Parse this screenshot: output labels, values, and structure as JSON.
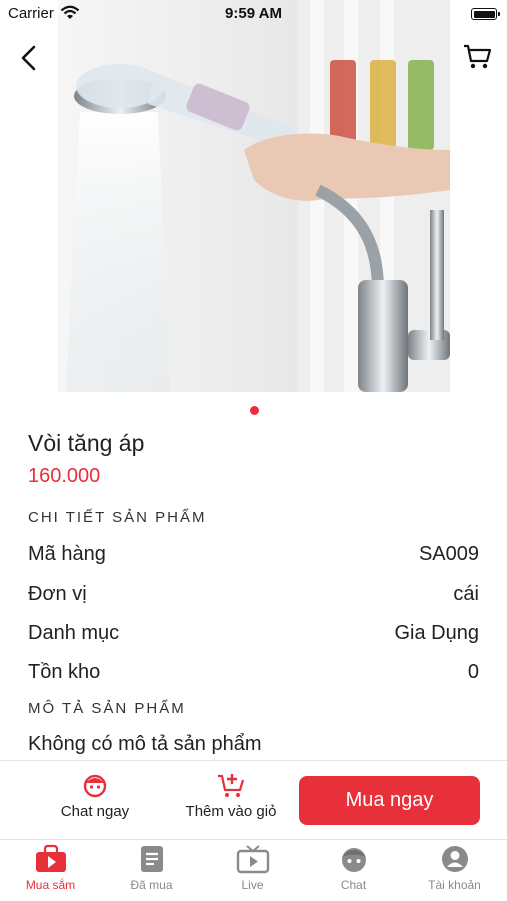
{
  "status_bar": {
    "carrier": "Carrier",
    "time": "9:59 AM"
  },
  "product": {
    "name": "Vòi tăng áp",
    "price": "160.000",
    "image_count": 1,
    "active_image_index": 0
  },
  "details": {
    "section_title": "CHI TIẾT SẢN PHẨM",
    "rows": [
      {
        "label": "Mã hàng",
        "value": "SA009"
      },
      {
        "label": "Đơn vị",
        "value": "cái"
      },
      {
        "label": "Danh mục",
        "value": "Gia Dụng"
      },
      {
        "label": "Tồn kho",
        "value": "0"
      }
    ]
  },
  "description": {
    "section_title": "MÔ TẢ SẢN PHẨM",
    "text": "Không có mô tả sản phẩm"
  },
  "actions": {
    "chat_label": "Chat ngay",
    "add_to_cart_label": "Thêm vào giỏ",
    "buy_label": "Mua ngay"
  },
  "tabs": [
    {
      "label": "Mua sắm",
      "icon": "shopping-bag-icon",
      "active": true
    },
    {
      "label": "Đã mua",
      "icon": "purchased-list-icon",
      "active": false
    },
    {
      "label": "Live",
      "icon": "tv-icon",
      "active": false
    },
    {
      "label": "Chat",
      "icon": "chat-face-icon",
      "active": false
    },
    {
      "label": "Tài khoản",
      "icon": "account-icon",
      "active": false
    }
  ],
  "colors": {
    "accent": "#e8303a",
    "inactive_tab": "#8a8a8a"
  }
}
